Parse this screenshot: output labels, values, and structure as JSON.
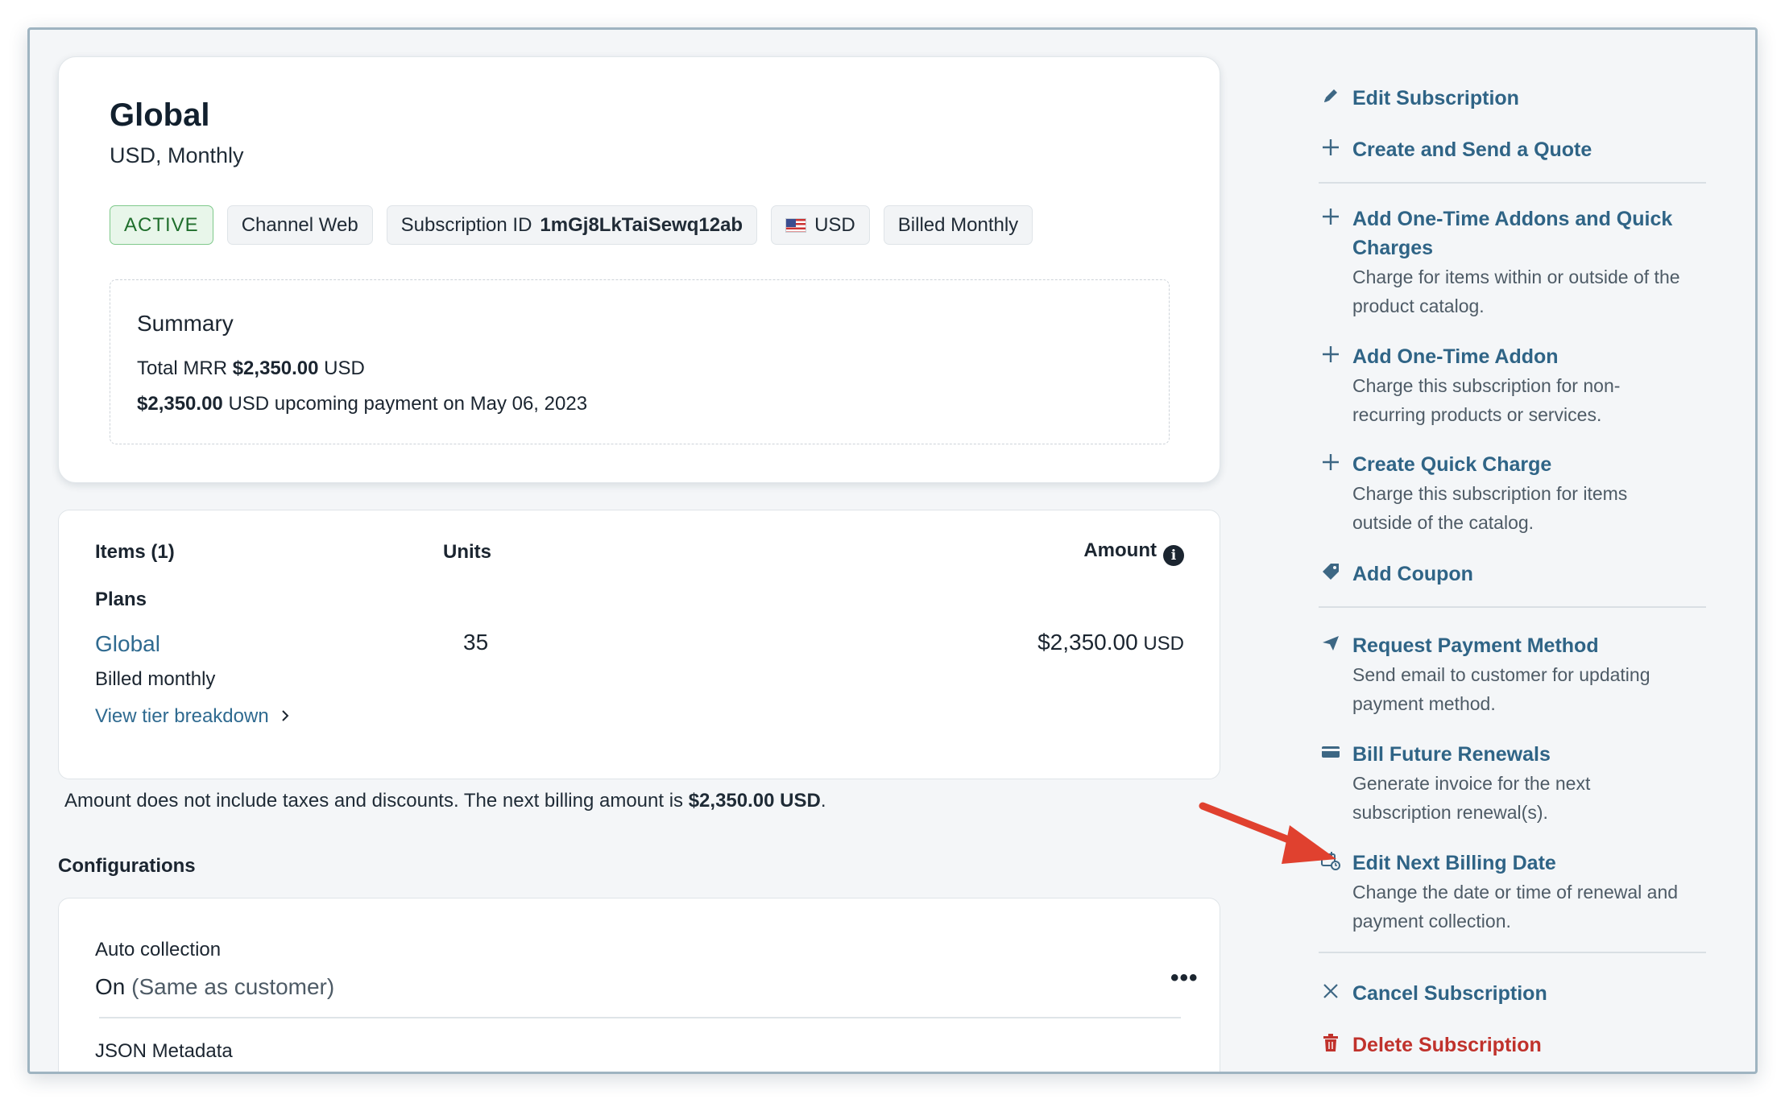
{
  "header": {
    "title": "Global",
    "subtitle": "USD, Monthly"
  },
  "badges": {
    "status": "ACTIVE",
    "channel": "Channel Web",
    "subscription_id_label": "Subscription ID",
    "subscription_id": "1mGj8LkTaiSewq12ab",
    "currency": "USD",
    "billing": "Billed Monthly"
  },
  "summary": {
    "title": "Summary",
    "mrr_label": "Total MRR",
    "mrr_value": "$2,350.00",
    "mrr_currency": "USD",
    "upcoming_value": "$2,350.00",
    "upcoming_text": "USD upcoming payment on May 06, 2023"
  },
  "items": {
    "col_items": "Items (1)",
    "col_units": "Units",
    "col_amount": "Amount",
    "section": "Plans",
    "plan_name": "Global",
    "plan_billing": "Billed monthly",
    "tier_link": "View tier breakdown",
    "units": "35",
    "amount": "$2,350.00",
    "amount_currency": "USD"
  },
  "note": {
    "text": "Amount does not include taxes and discounts. The next billing amount is",
    "amount": "$2,350.00 USD",
    "end": "."
  },
  "configurations": {
    "title": "Configurations",
    "auto_collection_label": "Auto collection",
    "auto_collection_value": "On",
    "auto_collection_note": "(Same as customer)",
    "json_metadata_label": "JSON Metadata"
  },
  "actions": {
    "edit_subscription": "Edit Subscription",
    "create_quote": "Create and Send a Quote",
    "addons_charges": "Add One-Time Addons and Quick",
    "addons_charges_2": "Charges",
    "addons_charges_desc_1": "Charge for items within or outside of the",
    "addons_charges_desc_2": "product catalog.",
    "one_time_addon": "Add One-Time Addon",
    "one_time_addon_desc_1": "Charge this subscription for non-",
    "one_time_addon_desc_2": "recurring products or services.",
    "quick_charge": "Create Quick Charge",
    "quick_charge_desc_1": "Charge this subscription for items",
    "quick_charge_desc_2": "outside of the catalog.",
    "add_coupon": "Add Coupon",
    "request_payment": "Request Payment Method",
    "request_payment_desc_1": "Send email to customer for updating",
    "request_payment_desc_2": "payment method.",
    "bill_future": "Bill Future Renewals",
    "bill_future_desc_1": "Generate invoice for the next",
    "bill_future_desc_2": "subscription renewal(s).",
    "edit_billing_date": "Edit Next Billing Date",
    "edit_billing_date_desc_1": "Change the date or time of renewal and",
    "edit_billing_date_desc_2": "payment collection.",
    "cancel_subscription": "Cancel Subscription",
    "delete_subscription": "Delete Subscription"
  },
  "colors": {
    "accent_link": "#2f6486",
    "danger": "#c0322c",
    "active_badge": "#1f6e2c",
    "annotation_arrow": "#e0412f"
  },
  "icons": [
    "pencil-icon",
    "plus-icon",
    "tag-icon",
    "send-icon",
    "card-icon",
    "calendar-clock-icon",
    "close-icon",
    "trash-icon",
    "info-icon",
    "chevron-right-icon",
    "more-icon",
    "flag-us-icon"
  ]
}
